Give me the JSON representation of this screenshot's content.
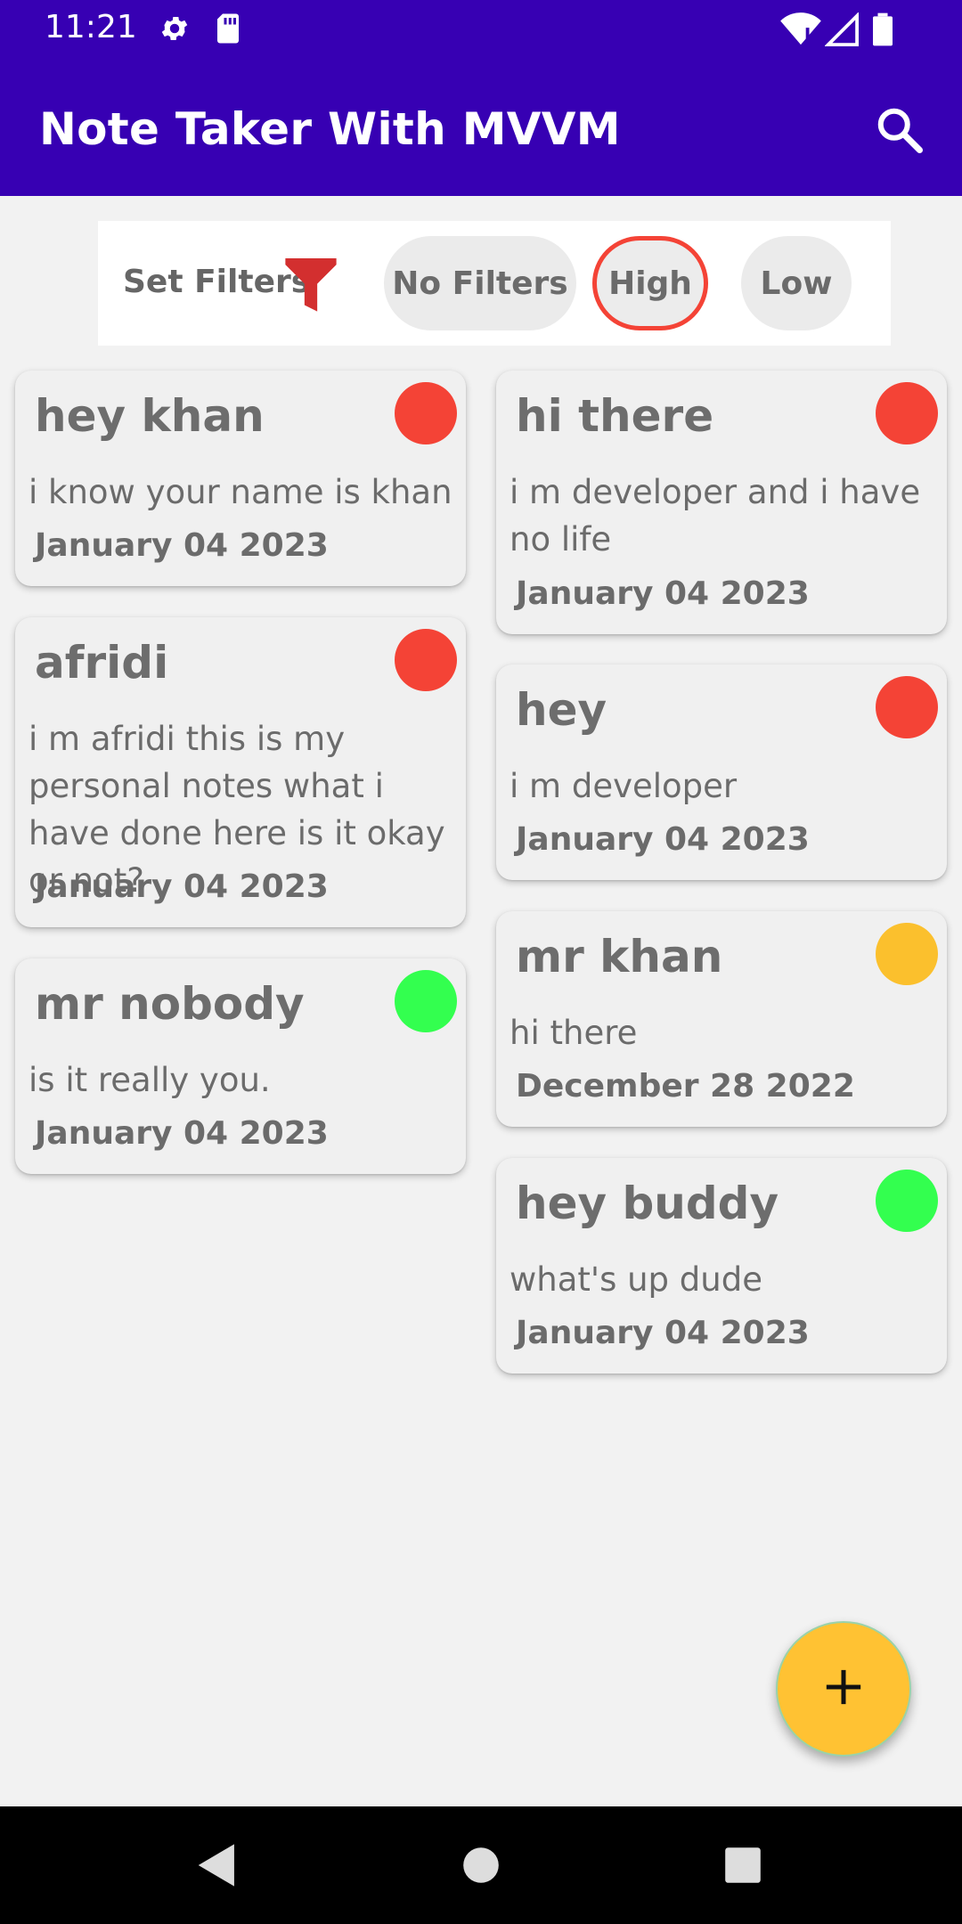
{
  "status_bar": {
    "time": "11:21",
    "icons": [
      "settings-icon",
      "sd-card-icon",
      "wifi-icon",
      "signal-icon",
      "battery-icon"
    ]
  },
  "app_bar": {
    "title": "Note Taker With MVVM",
    "search_icon": "search-icon"
  },
  "filters": {
    "label": "Set Filters",
    "icon": "funnel-icon",
    "chips": [
      {
        "label": "No Filters",
        "selected": false
      },
      {
        "label": "High",
        "selected": true
      },
      {
        "label": "Low",
        "selected": false
      }
    ]
  },
  "colors": {
    "primary": "#3700B3",
    "high": "#F44336",
    "medium": "#FBC02D",
    "low": "#33FF4F",
    "fab": "#FFC233"
  },
  "notes_left": [
    {
      "title": "hey khan",
      "body": "i know your name is khan",
      "date": "January 04 2023",
      "priority": "high"
    },
    {
      "title": "afridi",
      "body": "i m afridi this is my personal notes what i have done here is it okay or not?",
      "date": "January 04 2023",
      "priority": "high"
    },
    {
      "title": "mr nobody",
      "body": "is it really you.",
      "date": "January 04 2023",
      "priority": "low"
    }
  ],
  "notes_right": [
    {
      "title": "hi there",
      "body": "i m developer and i have no life",
      "date": "January 04 2023",
      "priority": "high"
    },
    {
      "title": "hey",
      "body": "i m developer",
      "date": "January 04 2023",
      "priority": "high"
    },
    {
      "title": "mr khan",
      "body": "hi there",
      "date": "December 28 2022",
      "priority": "medium"
    },
    {
      "title": "hey buddy",
      "body": "what's up dude",
      "date": "January 04 2023",
      "priority": "low"
    }
  ],
  "fab": {
    "icon": "plus-icon"
  },
  "nav": {
    "icons": [
      "back-icon",
      "home-icon",
      "recents-icon"
    ]
  }
}
